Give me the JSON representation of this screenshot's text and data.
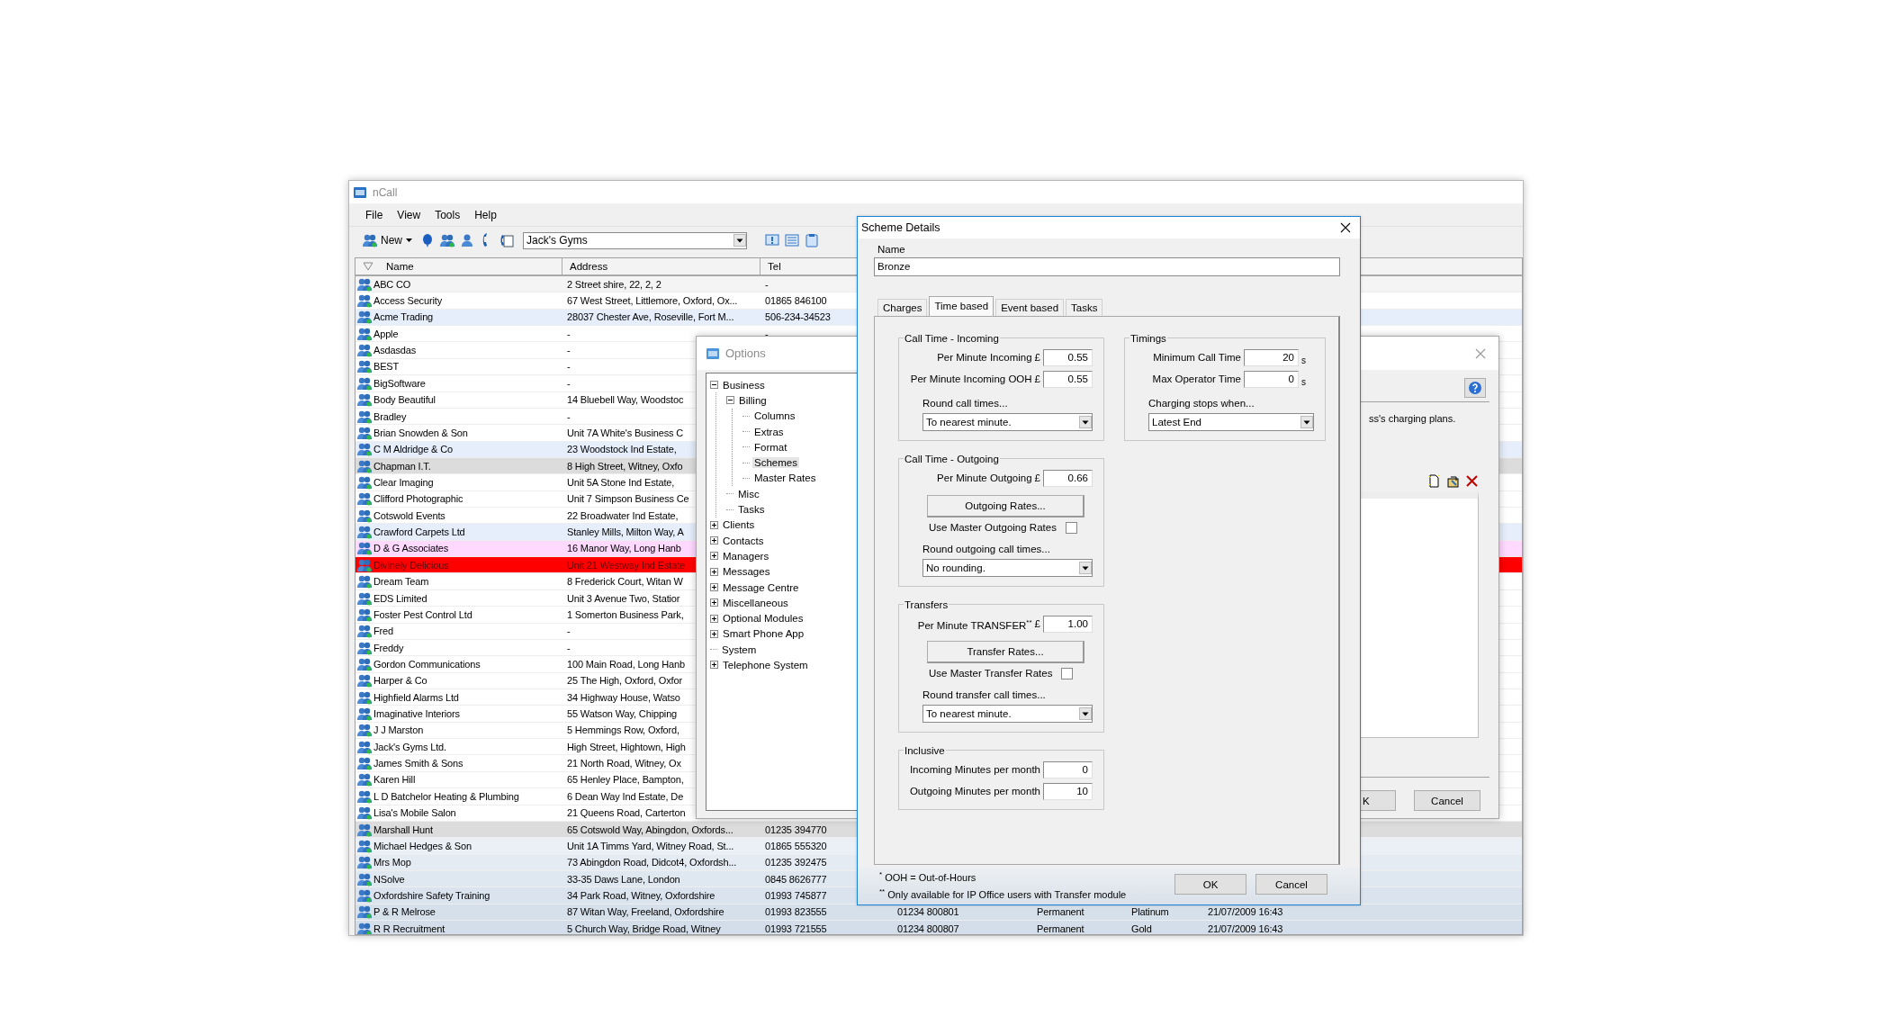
{
  "main_window": {
    "title": "nCall",
    "menu": [
      "File",
      "View",
      "Tools",
      "Help"
    ],
    "toolbar": {
      "new_button": "New",
      "client_combo": "Jack's Gyms"
    },
    "table": {
      "columns": [
        "Name",
        "Address",
        "Tel"
      ],
      "rows": [
        {
          "name": "ABC CO",
          "address": "2 Street shire, 22, 2, 2",
          "tel": "-",
          "color": "#f4f4f4"
        },
        {
          "name": "Access Security",
          "address": "67 West Street, Littlemore, Oxford, Ox...",
          "tel": "01865 846100",
          "color": "#ffffff"
        },
        {
          "name": "Acme Trading",
          "address": "28037 Chester Ave, Roseville, Fort M...",
          "tel": "506-234-34523",
          "color": "#e5eefa"
        },
        {
          "name": "Apple",
          "address": "-",
          "tel": "-",
          "color": "#ffffff"
        },
        {
          "name": "Asdasdas",
          "address": "-",
          "color": "#ffffff"
        },
        {
          "name": "BEST",
          "address": "-",
          "color": "#ffffff"
        },
        {
          "name": "BigSoftware",
          "address": "-",
          "color": "#ffffff"
        },
        {
          "name": "Body Beautiful",
          "address": "14 Bluebell Way, Woodstoc",
          "color": "#ffffff"
        },
        {
          "name": "Bradley",
          "address": "-",
          "color": "#ffffff"
        },
        {
          "name": "Brian Snowden & Son",
          "address": "Unit 7A White's Business C",
          "color": "#ffffff"
        },
        {
          "name": "C M Aldridge & Co",
          "address": "23 Woodstock Ind Estate,",
          "color": "#e5eefa"
        },
        {
          "name": "Chapman I.T.",
          "address": "8 High Street, Witney, Oxfo",
          "color": "#dcdcdc"
        },
        {
          "name": "Clear Imaging",
          "address": "Unit 5A Stone Ind Estate,",
          "color": "#ffffff"
        },
        {
          "name": "Clifford Photographic",
          "address": "Unit 7 Simpson Business Ce",
          "color": "#ffffff"
        },
        {
          "name": "Cotswold Events",
          "address": "22 Broadwater Ind Estate,",
          "color": "#ffffff"
        },
        {
          "name": "Crawford Carpets Ltd",
          "address": "Stanley Mills, Milton Way, A",
          "color": "#e5eefa"
        },
        {
          "name": "D & G Associates",
          "address": "16 Manor Way, Long Hanb",
          "color": "#ffd9ff"
        },
        {
          "name": "Divinely Delicious",
          "address": "Unit 21 Westway Ind Estate",
          "color": "#ff0000"
        },
        {
          "name": "Dream Team",
          "address": "8 Frederick Court, Witan W",
          "color": "#ffffff"
        },
        {
          "name": "EDS Limited",
          "address": "Unit 3 Avenue Two, Statior",
          "color": "#ffffff"
        },
        {
          "name": "Foster Pest Control Ltd",
          "address": "1 Somerton Business Park,",
          "color": "#ffffff"
        },
        {
          "name": "Fred",
          "address": "-",
          "color": "#ffffff"
        },
        {
          "name": "Freddy",
          "address": "-",
          "color": "#ffffff"
        },
        {
          "name": "Gordon Communications",
          "address": "100 Main Road, Long Hanb",
          "color": "#ffffff"
        },
        {
          "name": "Harper & Co",
          "address": "25 The High, Oxford, Oxfor",
          "color": "#ffffff"
        },
        {
          "name": "Highfield Alarms Ltd",
          "address": "34 Highway House, Watso",
          "color": "#ffffff"
        },
        {
          "name": "Imaginative Interiors",
          "address": "55 Watson Way, Chipping",
          "color": "#ffffff"
        },
        {
          "name": "J J Marston",
          "address": "5 Hemmings Row, Oxford,",
          "color": "#ffffff"
        },
        {
          "name": "Jack's Gyms Ltd.",
          "address": "High Street, Hightown, High",
          "color": "#ffffff"
        },
        {
          "name": "James Smith & Sons",
          "address": "21 North Road, Witney, Ox",
          "color": "#ffffff"
        },
        {
          "name": "Karen Hill",
          "address": "65 Henley Place, Bampton,",
          "color": "#ffffff"
        },
        {
          "name": "L D Batchelor Heating & Plumbing",
          "address": "6 Dean Way Ind Estate, De",
          "color": "#ffffff"
        },
        {
          "name": "Lisa's Mobile Salon",
          "address": "21 Queens Road, Carterton",
          "color": "#ffffff"
        },
        {
          "name": "Marshall Hunt",
          "address": "65 Cotswold Way, Abingdon, Oxfords...",
          "tel": "01235 394770",
          "color": "#dcdcdc"
        },
        {
          "name": "Michael Hedges & Son",
          "address": "Unit 1A Timms Yard, Witney Road, St...",
          "tel": "01865 555320",
          "color": "#eaf0f6"
        },
        {
          "name": "Mrs Mop",
          "address": "73 Abingdon Road, Didcot4, Oxfordsh...",
          "tel": "01235 392475",
          "color": "#e4ebf3"
        },
        {
          "name": "NSolve",
          "address": "33-35 Daws Lane, London",
          "tel": "0845 8626777",
          "color": "#dfe7f0"
        },
        {
          "name": "Oxfordshire Safety Training",
          "address": "34 Park Road, Witney, Oxfordshire",
          "tel": "01993 745877",
          "color": "#dae3ee"
        },
        {
          "name": "P & R Melrose",
          "address": "87 Witan Way, Freeland, Oxfordshire",
          "tel": "01993 823555",
          "column_4": "01234 800801",
          "column_5": "Permanent",
          "column_6": "Platinum",
          "column_7": "21/07/2009 16:43",
          "color": "#d6e0eb"
        },
        {
          "name": "R R Recruitment",
          "address": "5 Church Way, Bridge Road, Witney",
          "tel": "01993 721555",
          "column_4": "01234 800807",
          "column_5": "Permanent",
          "column_6": "Gold",
          "column_7": "21/07/2009 16:43",
          "color": "#d3deea"
        }
      ]
    }
  },
  "options_dialog": {
    "title": "Options",
    "tree": [
      {
        "label": "Business",
        "selected": false,
        "expanded": true,
        "children": [
          {
            "label": "Billing",
            "selected": false,
            "expanded": true,
            "children": [
              {
                "label": "Columns",
                "selected": false
              },
              {
                "label": "Extras",
                "selected": false
              },
              {
                "label": "Format",
                "selected": false
              },
              {
                "label": "Schemes",
                "selected": true
              },
              {
                "label": "Master Rates",
                "selected": false
              }
            ]
          },
          {
            "label": "Misc",
            "selected": false
          },
          {
            "label": "Tasks",
            "selected": false
          }
        ]
      },
      {
        "label": "Clients",
        "selected": false,
        "expanded": false
      },
      {
        "label": "Contacts",
        "selected": false,
        "expanded": false
      },
      {
        "label": "Managers",
        "selected": false,
        "expanded": false
      },
      {
        "label": "Messages",
        "selected": false,
        "expanded": false
      },
      {
        "label": "Message Centre",
        "selected": false,
        "expanded": false
      },
      {
        "label": "Miscellaneous",
        "selected": false,
        "expanded": false
      },
      {
        "label": "Optional Modules",
        "selected": false,
        "expanded": false
      },
      {
        "label": "Smart Phone App",
        "selected": false,
        "expanded": false
      },
      {
        "label": "System",
        "selected": false
      },
      {
        "label": "Telephone System",
        "selected": false,
        "expanded": false
      }
    ],
    "description": "ss's charging plans.",
    "buttons": [
      "K",
      "Cancel"
    ]
  },
  "scheme_dialog": {
    "title": "Scheme Details",
    "name_label": "Name",
    "name_value": "Bronze",
    "tabs": [
      {
        "label": "Charges",
        "selected": false
      },
      {
        "label": "Time based",
        "selected": true
      },
      {
        "label": "Event based",
        "selected": false
      },
      {
        "label": "Tasks",
        "selected": false
      }
    ],
    "left_groups": [
      {
        "title": "Call Time - Incoming",
        "items": [
          {
            "kind": "money",
            "label": "Per Minute Incoming",
            "currency": "£",
            "value": "0.55"
          },
          {
            "kind": "money",
            "label": "Per Minute Incoming OOH",
            "currency": "£",
            "value": "0.55"
          },
          {
            "kind": "select",
            "label": "Round call times...",
            "value": "To nearest minute."
          }
        ]
      },
      {
        "title": "Call Time - Outgoing",
        "items": [
          {
            "kind": "money",
            "label": "Per Minute Outgoing",
            "currency": "£",
            "value": "0.66"
          },
          {
            "kind": "button",
            "label": "Outgoing Rates..."
          },
          {
            "kind": "checkbox",
            "label": "Use Master Outgoing Rates",
            "checked": false
          },
          {
            "kind": "select",
            "label": "Round outgoing call times...",
            "value": "No rounding."
          }
        ]
      },
      {
        "title": "Transfers",
        "items": [
          {
            "kind": "money",
            "label": "Per Minute TRANSFER$^{**}$",
            "currency": "£",
            "value": "1.00"
          },
          {
            "kind": "button",
            "label": "Transfer Rates..."
          },
          {
            "kind": "checkbox",
            "label": "Use Master Transfer Rates",
            "checked": false
          },
          {
            "kind": "select",
            "label": "Round transfer call times...",
            "value": "To nearest minute."
          }
        ]
      },
      {
        "title": "Inclusive",
        "items": [
          {
            "kind": "number",
            "label": "Incoming Minutes per month",
            "value": "0"
          },
          {
            "kind": "number",
            "label": "Outgoing Minutes per month",
            "value": "10"
          }
        ]
      }
    ],
    "right_groups": [
      {
        "title": "Timings",
        "items": [
          {
            "kind": "seconds",
            "label": "Minimum Call Time",
            "value": "20",
            "unit": "s"
          },
          {
            "kind": "seconds",
            "label": "Max Operator Time",
            "value": "0",
            "unit": "s"
          },
          {
            "kind": "select",
            "label": "Charging stops when...",
            "value": "Latest End"
          }
        ]
      }
    ],
    "notes": [
      "$^{*}$ OOH = Out-of-Hours",
      "$^{**}$ Only available for IP Office users with Transfer module"
    ],
    "buttons": [
      "OK",
      "Cancel"
    ]
  }
}
